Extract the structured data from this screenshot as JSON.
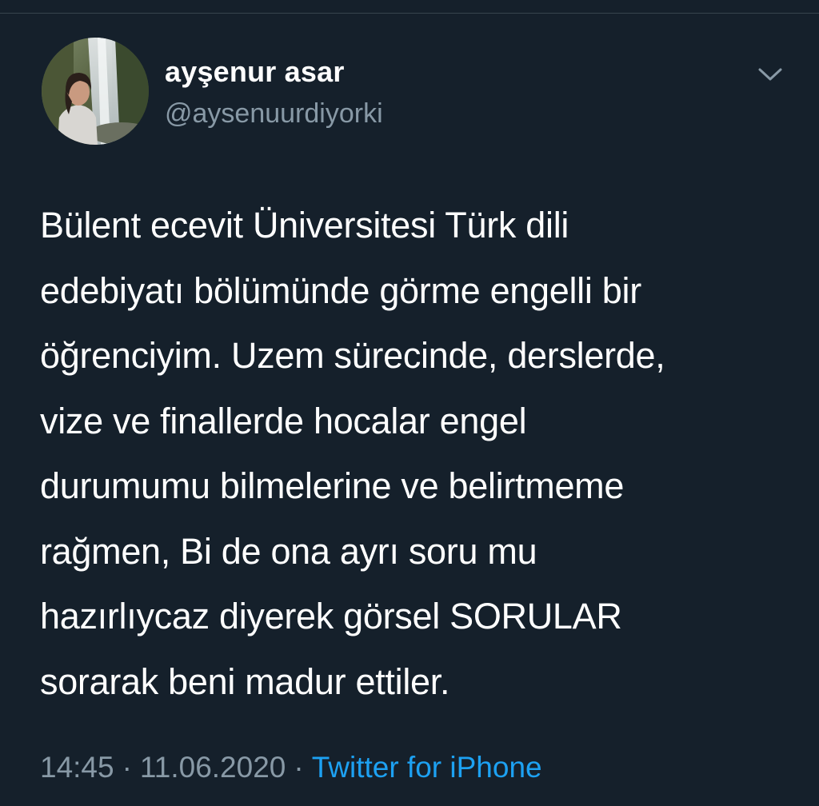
{
  "tweet": {
    "author": {
      "display_name": "ayşenur asar",
      "handle": "@aysenuurdiyorki",
      "avatar_icon": "profile-photo"
    },
    "menu_icon": "chevron-down-icon",
    "text_lines": [
      "Bülent ecevit Üniversitesi Türk dili",
      "edebiyatı bölümünde görme engelli bir",
      "öğrenciyim. Uzem sürecinde, derslerde,",
      "vize ve finallerde hocalar engel",
      "durumumu bilmelerine ve belirtmeme",
      "rağmen, Bi de ona ayrı soru mu",
      "hazırlıycaz diyerek görsel SORULAR",
      "sorarak beni madur ettiler."
    ],
    "meta": {
      "time": "14:45",
      "separator": "·",
      "date": "11.06.2020",
      "source": "Twitter for iPhone"
    }
  },
  "colors": {
    "background": "#15202b",
    "text": "#ffffff",
    "secondary_text": "#8899a6",
    "link": "#1da1f2",
    "divider": "#38444d"
  }
}
